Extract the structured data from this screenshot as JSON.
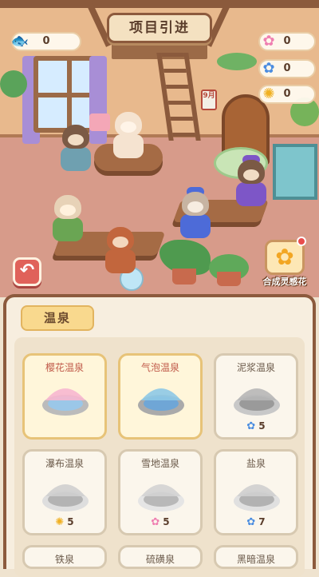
{
  "header": {
    "title": "项目引进"
  },
  "resources": {
    "fish": {
      "icon": "fish-icon",
      "value": "0"
    },
    "pink_flower": {
      "icon": "pink-flower-icon",
      "value": "0"
    },
    "blue_flower": {
      "icon": "blue-flower-icon",
      "value": "0"
    },
    "sunflower": {
      "icon": "sunflower-icon",
      "value": "0"
    }
  },
  "scene": {
    "calendar_label": "9月"
  },
  "back_button": {
    "icon": "back-arrow-icon",
    "symbol": "↶"
  },
  "craft_button": {
    "label": "合成灵感花",
    "icon": "flower-bundle-icon"
  },
  "panel": {
    "tab_label": "温泉",
    "cards": [
      {
        "name": "樱花温泉",
        "selected": true,
        "cost": "",
        "cost_icon": ""
      },
      {
        "name": "气泡温泉",
        "selected": true,
        "cost": "",
        "cost_icon": ""
      },
      {
        "name": "泥浆温泉",
        "selected": false,
        "cost": "5",
        "cost_icon": "blue-flower-icon"
      },
      {
        "name": "瀑布温泉",
        "selected": false,
        "cost": "5",
        "cost_icon": "sunflower-icon"
      },
      {
        "name": "雪地温泉",
        "selected": false,
        "cost": "5",
        "cost_icon": "pink-flower-icon"
      },
      {
        "name": "盐泉",
        "selected": false,
        "cost": "7",
        "cost_icon": "blue-flower-icon"
      },
      {
        "name": "铁泉",
        "selected": false,
        "cost": "",
        "cost_icon": ""
      },
      {
        "name": "硫磺泉",
        "selected": false,
        "cost": "",
        "cost_icon": ""
      },
      {
        "name": "黑暗温泉",
        "selected": false,
        "cost": "",
        "cost_icon": ""
      }
    ]
  },
  "colors": {
    "accent_red": "#e0625a",
    "panel_border": "#8c5a3d",
    "selected_card_border": "#e7c378",
    "tab_yellow": "#f9d98e"
  }
}
